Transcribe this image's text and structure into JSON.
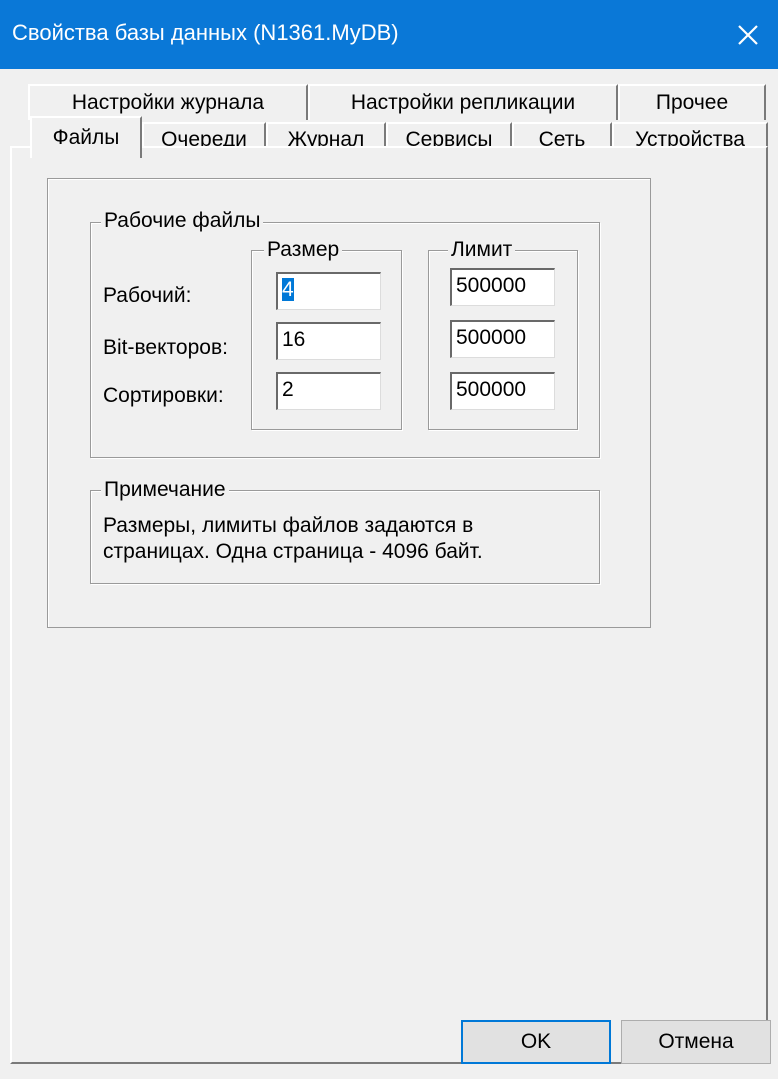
{
  "window": {
    "title": "Свойства базы данных (N1361.MyDB)"
  },
  "tabs_row_back": [
    "Настройки журнала",
    "Настройки репликации",
    "Прочее"
  ],
  "tabs_row_front": [
    "Файлы",
    "Очереди",
    "Журнал",
    "Сервисы",
    "Сеть",
    "Устройства"
  ],
  "active_tab": "Файлы",
  "work_files": {
    "group_label": "Рабочие файлы",
    "size_label": "Размер",
    "limit_label": "Лимит",
    "rows": [
      {
        "label": "Рабочий:",
        "size": "4",
        "limit": "500000"
      },
      {
        "label": "Bit-векторов:",
        "size": "16",
        "limit": "500000"
      },
      {
        "label": "Сортировки:",
        "size": "2",
        "limit": "500000"
      }
    ]
  },
  "note": {
    "group_label": "Примечание",
    "line1": "Размеры, лимиты файлов задаются в",
    "line2": "страницах. Одна страница - 4096 байт."
  },
  "buttons": {
    "ok": "OK",
    "cancel": "Отмена"
  },
  "colors": {
    "titlebar": "#0a78d7",
    "selection": "#0078d7"
  }
}
